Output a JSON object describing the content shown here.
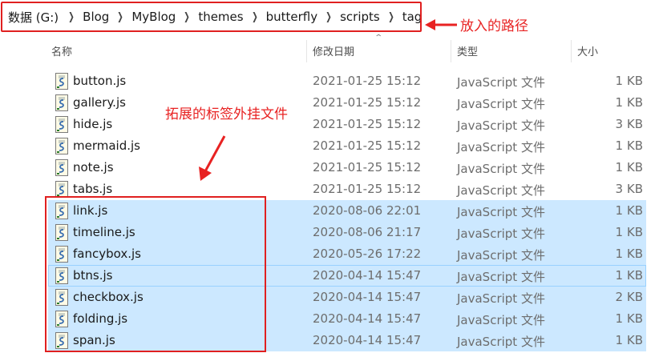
{
  "breadcrumb": {
    "drive": "数据 (G:)",
    "folders": [
      "Blog",
      "MyBlog",
      "themes",
      "butterfly",
      "scripts",
      "tag"
    ],
    "separator_icon": "chevron-right-icon"
  },
  "columns": {
    "name": "名称",
    "modified": "修改日期",
    "type": "类型",
    "size": "大小"
  },
  "files": [
    {
      "name": "button.js",
      "modified": "2021-01-25 15:12",
      "type": "JavaScript 文件",
      "size": "1 KB",
      "selected": false
    },
    {
      "name": "gallery.js",
      "modified": "2021-01-25 15:12",
      "type": "JavaScript 文件",
      "size": "1 KB",
      "selected": false
    },
    {
      "name": "hide.js",
      "modified": "2021-01-25 15:12",
      "type": "JavaScript 文件",
      "size": "3 KB",
      "selected": false
    },
    {
      "name": "mermaid.js",
      "modified": "2021-01-25 15:12",
      "type": "JavaScript 文件",
      "size": "1 KB",
      "selected": false
    },
    {
      "name": "note.js",
      "modified": "2021-01-25 15:12",
      "type": "JavaScript 文件",
      "size": "1 KB",
      "selected": false
    },
    {
      "name": "tabs.js",
      "modified": "2021-01-25 15:12",
      "type": "JavaScript 文件",
      "size": "3 KB",
      "selected": false
    },
    {
      "name": "link.js",
      "modified": "2020-08-06 22:01",
      "type": "JavaScript 文件",
      "size": "1 KB",
      "selected": true
    },
    {
      "name": "timeline.js",
      "modified": "2020-08-06 21:17",
      "type": "JavaScript 文件",
      "size": "1 KB",
      "selected": true
    },
    {
      "name": "fancybox.js",
      "modified": "2020-05-26 17:22",
      "type": "JavaScript 文件",
      "size": "1 KB",
      "selected": true
    },
    {
      "name": "btns.js",
      "modified": "2020-04-14 15:47",
      "type": "JavaScript 文件",
      "size": "1 KB",
      "selected": true,
      "focused": true
    },
    {
      "name": "checkbox.js",
      "modified": "2020-04-14 15:47",
      "type": "JavaScript 文件",
      "size": "2 KB",
      "selected": true
    },
    {
      "name": "folding.js",
      "modified": "2020-04-14 15:47",
      "type": "JavaScript 文件",
      "size": "1 KB",
      "selected": true
    },
    {
      "name": "span.js",
      "modified": "2020-04-14 15:47",
      "type": "JavaScript 文件",
      "size": "1 KB",
      "selected": true
    }
  ],
  "annotations": {
    "path_label": "放入的路径",
    "extension_label": "拓展的标签外挂文件"
  },
  "colors": {
    "annotation": "#e82222",
    "selection": "#cce8ff",
    "focus_border": "#99d1ff"
  },
  "icons": {
    "file": "js-file-icon",
    "sort": "sort-caret-icon"
  }
}
